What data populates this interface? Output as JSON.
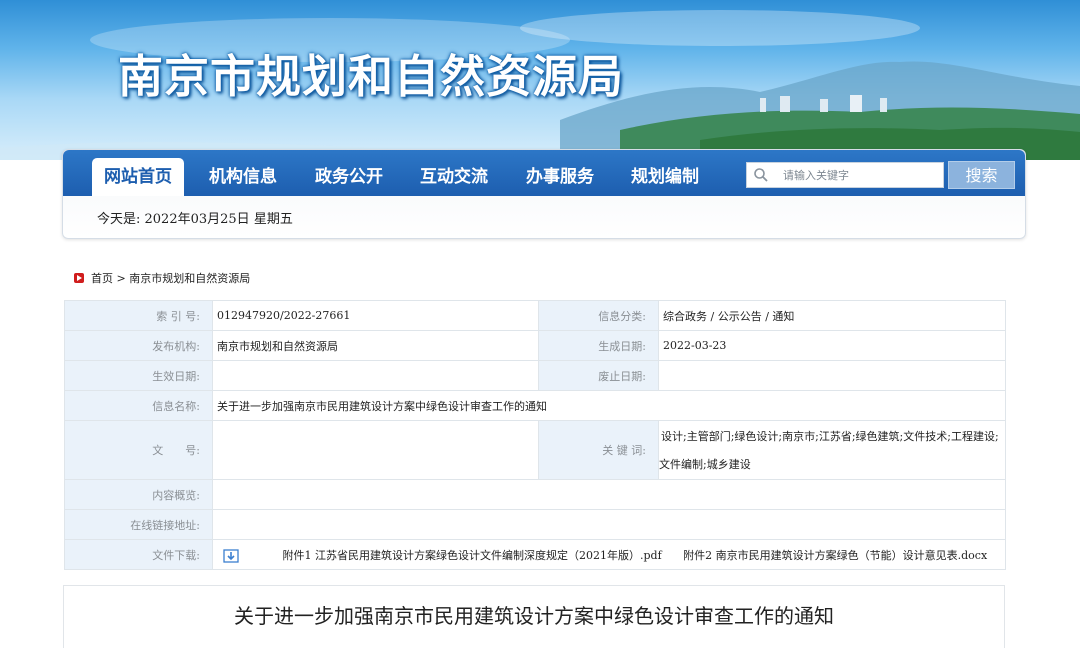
{
  "header": {
    "site_title": "南京市规划和自然资源局"
  },
  "nav": {
    "items": [
      {
        "label": "网站首页",
        "active": true
      },
      {
        "label": "机构信息",
        "active": false
      },
      {
        "label": "政务公开",
        "active": false
      },
      {
        "label": "互动交流",
        "active": false
      },
      {
        "label": "办事服务",
        "active": false
      },
      {
        "label": "规划编制",
        "active": false
      }
    ],
    "search_placeholder": "请输入关键字",
    "search_button": "搜索",
    "date_text": "今天是: 2022年03月25日 星期五"
  },
  "breadcrumb": {
    "text": "首页 > 南京市规划和自然资源局"
  },
  "info": {
    "index_label": "索 引 号:",
    "index_value": "012947920/2022-27661",
    "category_label": "信息分类:",
    "category_value": "综合政务 / 公示公告 / 通知",
    "publisher_label": "发布机构:",
    "publisher_value": "南京市规划和自然资源局",
    "created_label": "生成日期:",
    "created_value": "2022-03-23",
    "effective_label": "生效日期:",
    "effective_value": "",
    "expire_label": "废止日期:",
    "expire_value": "",
    "name_label": "信息名称:",
    "name_value": "关于进一步加强南京市民用建筑设计方案中绿色设计审查工作的通知",
    "docno_label": "文　　号:",
    "docno_value": "",
    "keywords_label": "关 键 词:",
    "keywords_line1": "设计;主管部门;绿色设计;南京市;江苏省;绿色建筑;文件技术;工程建设;",
    "keywords_line2": "文件编制;城乡建设",
    "summary_label": "内容概览:",
    "summary_value": "",
    "link_label": "在线链接地址:",
    "link_value": "",
    "download_label": "文件下载:",
    "attachment1": "附件1 江苏省民用建筑设计方案绿色设计文件编制深度规定（2021年版）.pdf",
    "attachment2": "附件2 南京市民用建筑设计方案绿色（节能）设计意见表.docx"
  },
  "article": {
    "title": "关于进一步加强南京市民用建筑设计方案中绿色设计审查工作的通知"
  },
  "colors": {
    "nav_blue": "#1d5eaf",
    "key_cell_bg": "#eaf2fa",
    "breadcrumb_icon": "#d01d1d"
  }
}
